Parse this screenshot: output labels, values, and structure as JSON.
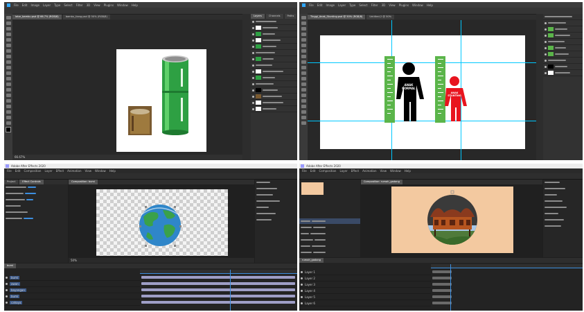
{
  "photoshop_1": {
    "menu": [
      "File",
      "Edit",
      "Image",
      "Layer",
      "Type",
      "Select",
      "Filter",
      "3D",
      "View",
      "Plugins",
      "Window",
      "Help"
    ],
    "tabs": [
      "latar_bambu.psd @ 66.7% (RGB/8)",
      "bambu_tiang.psd @ 50% (RGB/8)"
    ],
    "status": "66.67%",
    "panel_tabs": [
      "Layers",
      "Channels",
      "Paths"
    ]
  },
  "photoshop_2": {
    "menu": [
      "File",
      "Edit",
      "Image",
      "Layer",
      "Type",
      "Select",
      "Filter",
      "3D",
      "View",
      "Plugins",
      "Window",
      "Help"
    ],
    "tabs": [
      "Tinggi_Anak_Stunting.psd @ 50% (RGB/8)",
      "Untitled-2 @ 50%"
    ],
    "labels": {
      "normal": "ANAK\nNORMAL",
      "stunting": "ANAK\nSTUNTING"
    },
    "colors": {
      "normal": "#000000",
      "stunting": "#e8141e",
      "ruler": "#5bb54a",
      "guide": "#00c8ff"
    }
  },
  "aftereffects_1": {
    "menu": [
      "File",
      "Edit",
      "Composition",
      "Layer",
      "Effect",
      "Animation",
      "View",
      "Window",
      "Help"
    ],
    "title": "Adobe After Effects 2020",
    "panel_tabs": [
      "Project",
      "Effect Controls"
    ],
    "comp_tab": "Composition: bumi",
    "timeline_tab": "bumi",
    "zoom": "50%",
    "layers": [
      "bumi",
      "awan",
      "bayangan",
      "bumi",
      "cahaya"
    ],
    "colors": {
      "ocean": "#2f86c9",
      "land": "#3aa14a",
      "bar": "#9e9ec6"
    }
  },
  "aftereffects_2": {
    "menu": [
      "File",
      "Edit",
      "Composition",
      "Layer",
      "Effect",
      "Animation",
      "View",
      "Window",
      "Help"
    ],
    "title": "Adobe After Effects 2020",
    "comp_tab": "Composition: rumah_gadang",
    "timeline_tab": "rumah_gadang",
    "layers": [
      "Layer 1",
      "Layer 2",
      "Layer 3",
      "Layer 4",
      "Layer 5",
      "Layer 6"
    ],
    "colors": {
      "bg": "#f3c9a0",
      "circle": "#3a3a3a",
      "roof": "#8a3a1e"
    }
  }
}
